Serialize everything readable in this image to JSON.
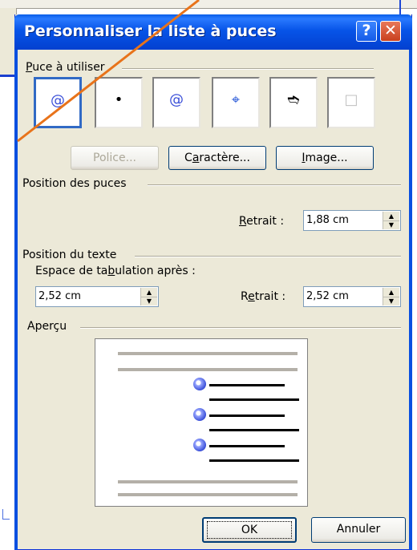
{
  "dialog": {
    "title": "Personnaliser la liste à puces",
    "help_label": "?",
    "close_label": "✕"
  },
  "bullets": {
    "group_label_pre": "",
    "group_label_u": "P",
    "group_label_post": "uce à utiliser",
    "items": [
      {
        "glyph": "@",
        "selected": true
      },
      {
        "glyph": "•",
        "selected": false
      },
      {
        "glyph": "@",
        "selected": false
      },
      {
        "glyph": "⌖",
        "selected": false
      },
      {
        "glyph": "➬",
        "selected": false
      },
      {
        "glyph": "□",
        "selected": false
      }
    ],
    "police_label": "Police...",
    "caractere_pre": "C",
    "caractere_u": "a",
    "caractere_post": "ractère...",
    "image_u": "I",
    "image_post": "mage..."
  },
  "bullet_position": {
    "group_label": "Position des puces",
    "indent_u": "R",
    "indent_post": "etrait :",
    "indent_value": "1,88 cm"
  },
  "text_position": {
    "group_label": "Position du texte",
    "tab_label_pre": "Espace de ta",
    "tab_label_u": "b",
    "tab_label_post": "ulation après :",
    "tab_value": "2,52 cm",
    "indent_pre": "R",
    "indent_u": "e",
    "indent_post": "trait :",
    "indent_value": "2,52 cm"
  },
  "preview": {
    "group_label": "Aperçu"
  },
  "footer": {
    "ok_label": "OK",
    "cancel_label": "Annuler"
  },
  "colors": {
    "title_blue": "#0754e8",
    "accent_orange": "#e8731a",
    "selection_blue": "#316ac5"
  }
}
